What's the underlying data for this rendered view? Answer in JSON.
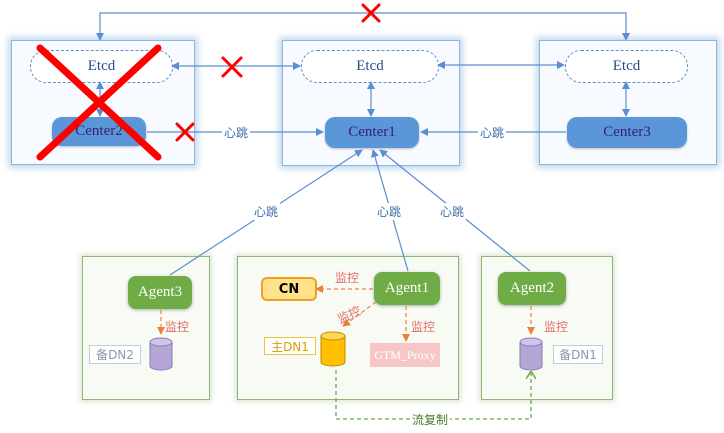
{
  "nodes": {
    "etcd_left": "Etcd",
    "etcd_mid": "Etcd",
    "etcd_right": "Etcd",
    "center2": "Center2",
    "center1": "Center1",
    "center3": "Center3",
    "agent3": "Agent3",
    "agent1": "Agent1",
    "agent2": "Agent2",
    "cn": "CN",
    "primary_dn1": "主DN1",
    "gtm_proxy": "GTM_Proxy",
    "standby_dn2": "备DN2",
    "standby_dn1": "备DN1"
  },
  "labels": {
    "heartbeat_c2": "心跳",
    "heartbeat_c3": "心跳",
    "heartbeat_a3": "心跳",
    "heartbeat_a1": "心跳",
    "heartbeat_a2": "心跳",
    "monitor_cn": "监控",
    "monitor_dn1": "监控",
    "monitor_gtm": "监控",
    "monitor_dn2": "监控",
    "monitor_sdn1": "监控",
    "replication": "流复制"
  },
  "colors": {
    "center_fill": "#5b96d8",
    "agent_fill": "#6fac46",
    "fail_mark": "#ff0000",
    "cn_fill": "#ffe28a",
    "primary_db": "#ffc000",
    "standby_db": "#b4a7d6"
  },
  "icons": [
    "fail-cross-icon",
    "database-cylinder-icon"
  ]
}
